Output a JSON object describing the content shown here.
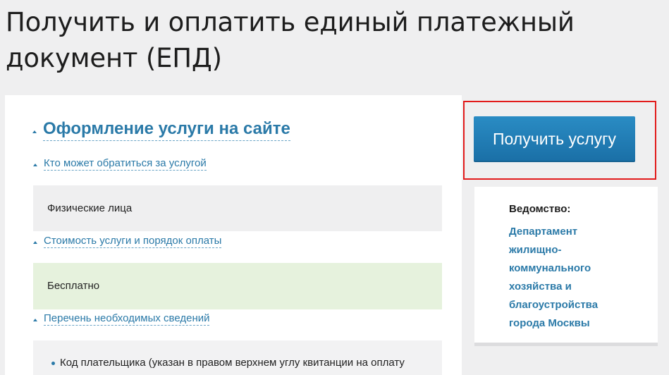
{
  "page": {
    "title": "Получить и оплатить единый платежный документ (ЕПД)"
  },
  "service_section": {
    "title": "Оформление услуги на сайте",
    "who_can_apply": {
      "link": "Кто может обратиться за услугой",
      "value": "Физические лица"
    },
    "cost": {
      "link": "Стоимость услуги и порядок оплаты",
      "value": "Бесплатно"
    },
    "required_info": {
      "link": "Перечень необходимых сведений",
      "items": [
        "Код плательщика (указан в правом верхнем углу квитанции на оплату"
      ]
    }
  },
  "sidebar": {
    "get_service_button": "Получить услугу",
    "agency_label": "Ведомство:",
    "agency_name": "Департамент жилищно-коммунального хозяйства и благоустройства города Москвы"
  },
  "colors": {
    "accent": "#2b7aa8",
    "highlight_border": "#e21b1b",
    "price_box": "#e6f2dd"
  }
}
